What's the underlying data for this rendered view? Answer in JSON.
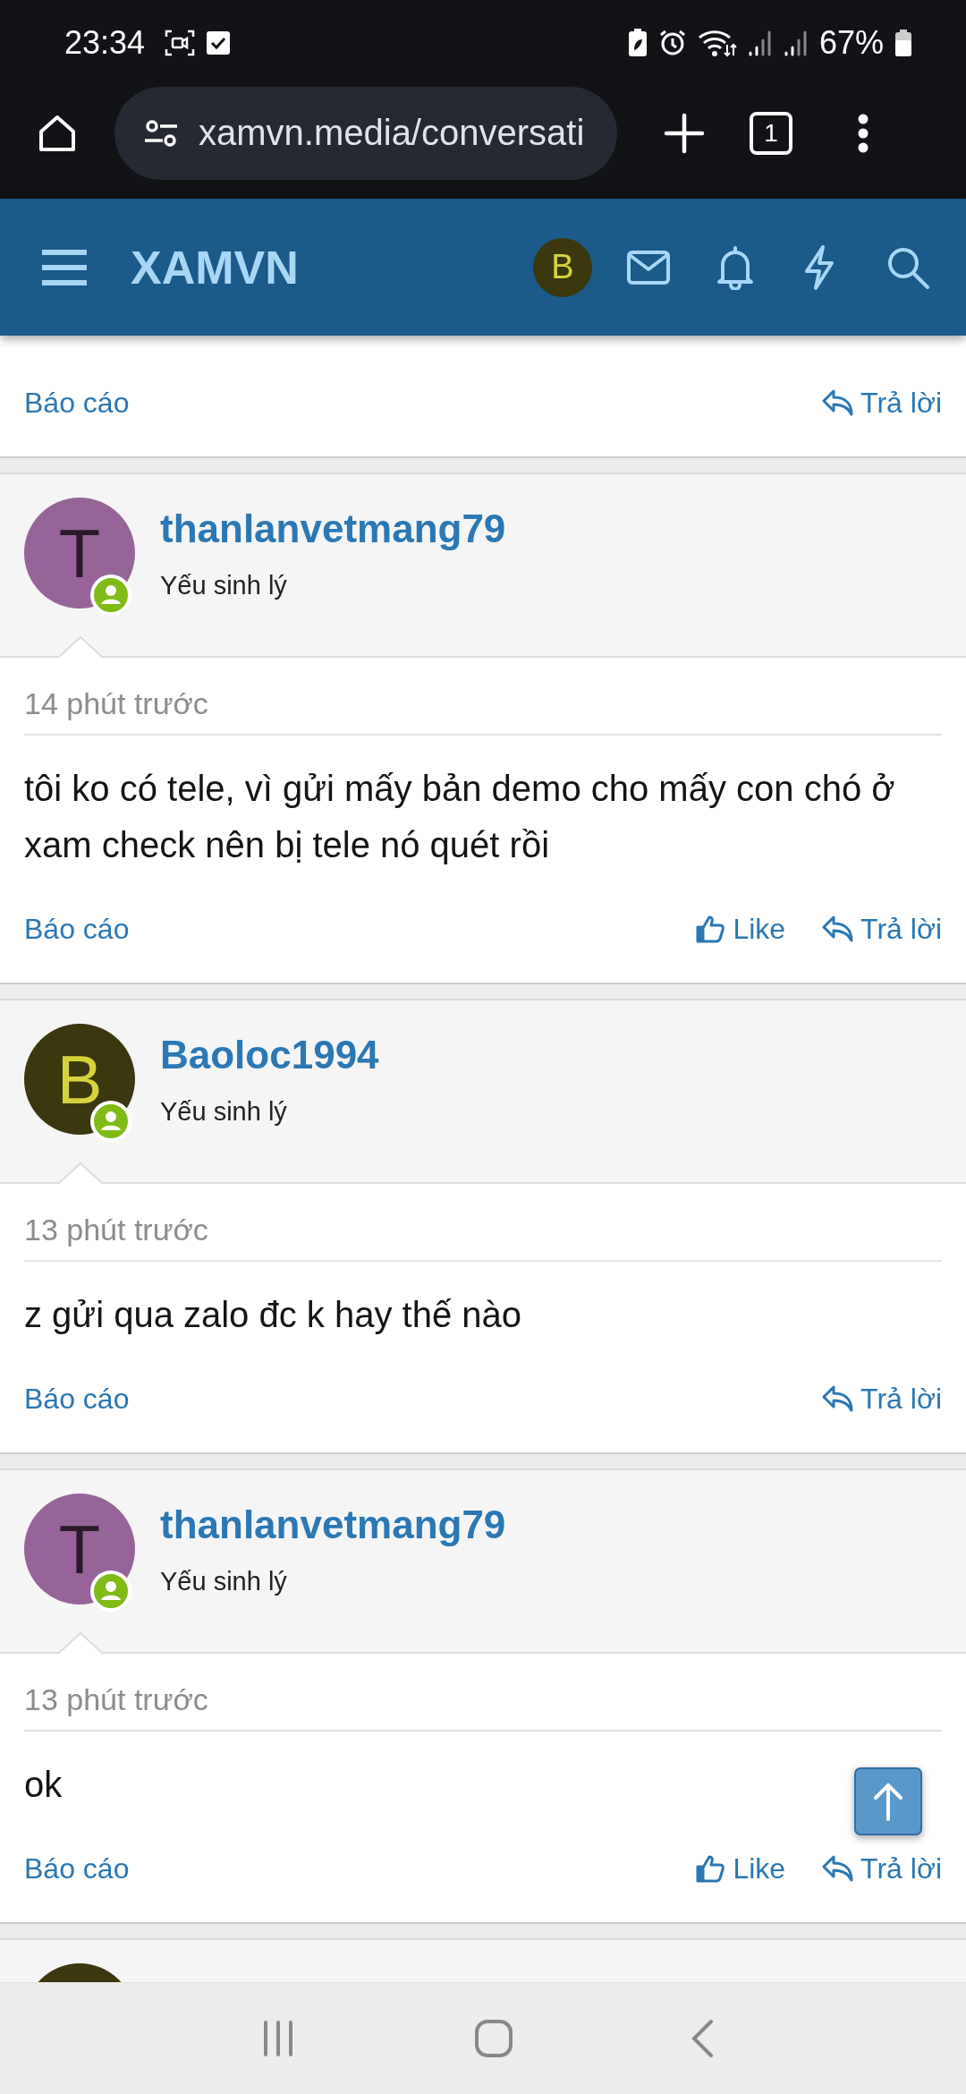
{
  "status_bar": {
    "time": "23:34",
    "battery": "67%"
  },
  "browser": {
    "url": "xamvn.media/conversati",
    "tab_count": "1"
  },
  "app_bar": {
    "logo": "XAMVN",
    "avatar": {
      "letter": "B",
      "color": "#3b3810"
    }
  },
  "posts": [
    {
      "kind": "tail",
      "report": "Báo cáo",
      "actions": [
        {
          "kind": "reply",
          "label": "Trả lời"
        }
      ]
    },
    {
      "kind": "full",
      "author": "thanlanvetmang79",
      "title": "Yếu sinh lý",
      "avatar": {
        "letter": "T",
        "color": "#97649a"
      },
      "time": "14 phút trước",
      "message": "tôi ko có tele, vì gửi mấy bản demo cho mấy con chó ở xam check nên bị tele nó quét rồi",
      "report": "Báo cáo",
      "actions": [
        {
          "kind": "like",
          "label": "Like"
        },
        {
          "kind": "reply",
          "label": "Trả lời"
        }
      ]
    },
    {
      "kind": "full",
      "author": "Baoloc1994",
      "title": "Yếu sinh lý",
      "avatar": {
        "letter": "B",
        "color": "#3b3810"
      },
      "time": "13 phút trước",
      "message": "z gửi qua zalo đc k hay thế nào",
      "report": "Báo cáo",
      "actions": [
        {
          "kind": "reply",
          "label": "Trả lời"
        }
      ]
    },
    {
      "kind": "full",
      "author": "thanlanvetmang79",
      "title": "Yếu sinh lý",
      "avatar": {
        "letter": "T",
        "color": "#97649a"
      },
      "time": "13 phút trước",
      "message": "ok",
      "report": "Báo cáo",
      "actions": [
        {
          "kind": "like",
          "label": "Like"
        },
        {
          "kind": "reply",
          "label": "Trả lời"
        }
      ]
    },
    {
      "kind": "cut",
      "avatar": {
        "color": "#3b3810"
      }
    }
  ]
}
